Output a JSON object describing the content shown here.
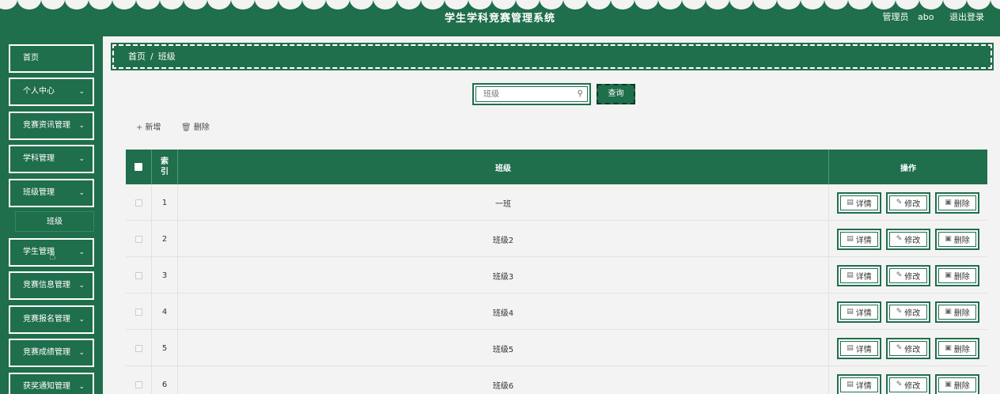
{
  "header": {
    "title": "学生学科竞赛管理系统",
    "user_label": "管理员",
    "username": "abo",
    "logout": "退出登录"
  },
  "sidebar": {
    "items": [
      {
        "label": "首页",
        "has_chevron": false
      },
      {
        "label": "个人中心",
        "has_chevron": true
      },
      {
        "label": "竞赛资讯管理",
        "has_chevron": true
      },
      {
        "label": "学科管理",
        "has_chevron": true
      },
      {
        "label": "班级管理",
        "has_chevron": true
      },
      {
        "label": "学生管理",
        "has_chevron": true
      },
      {
        "label": "竞赛信息管理",
        "has_chevron": true
      },
      {
        "label": "竞赛报名管理",
        "has_chevron": true
      },
      {
        "label": "竞赛成绩管理",
        "has_chevron": true
      },
      {
        "label": "获奖通知管理",
        "has_chevron": true
      }
    ],
    "submenu": {
      "label": "班级"
    }
  },
  "breadcrumb": {
    "home": "首页",
    "separator": "/",
    "current": "班级"
  },
  "search": {
    "placeholder": "班级",
    "button": "查询"
  },
  "toolbar": {
    "add": "新增",
    "delete": "删除"
  },
  "table": {
    "headers": {
      "index": "索引",
      "class": "班级",
      "actions": "操作"
    },
    "actions": {
      "detail": "详情",
      "edit": "修改",
      "delete": "删除"
    },
    "rows": [
      {
        "index": "1",
        "class": "一班"
      },
      {
        "index": "2",
        "class": "班级2"
      },
      {
        "index": "3",
        "class": "班级3"
      },
      {
        "index": "4",
        "class": "班级4"
      },
      {
        "index": "5",
        "class": "班级5"
      },
      {
        "index": "6",
        "class": "班级6"
      }
    ]
  },
  "colors": {
    "primary": "#1f6e4c",
    "background": "#f3f3f3"
  }
}
